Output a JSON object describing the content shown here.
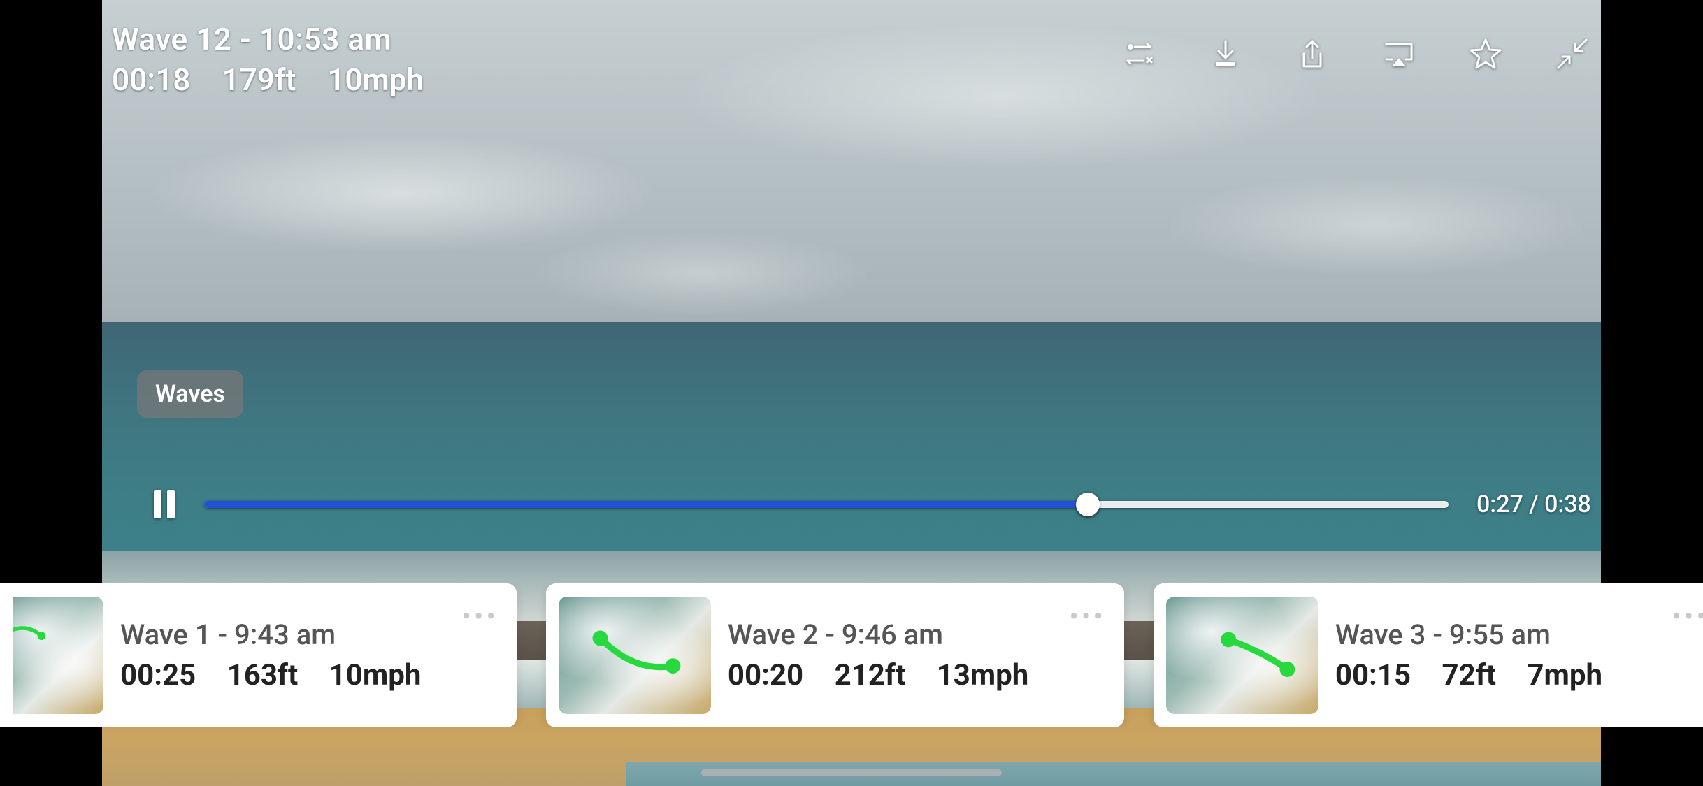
{
  "overlay": {
    "title": "Wave  12 - 10:53 am",
    "duration": "00:18",
    "distance": "179ft",
    "speed": "10mph"
  },
  "chip": {
    "label": "Waves"
  },
  "playback": {
    "current": "0:27",
    "total": "0:38",
    "progress_pct": 71
  },
  "toolbar_icons": [
    "trim-icon",
    "download-icon",
    "share-icon",
    "airplay-icon",
    "star-icon",
    "exit-fullscreen-icon"
  ],
  "cards": [
    {
      "title": "Wave  1 - 9:43 am",
      "duration": "00:25",
      "distance": "163ft",
      "speed": "10mph"
    },
    {
      "title": "Wave  2 - 9:46 am",
      "duration": "00:20",
      "distance": "212ft",
      "speed": "13mph"
    },
    {
      "title": "Wave  3 - 9:55 am",
      "duration": "00:15",
      "distance": "72ft",
      "speed": "7mph"
    }
  ]
}
